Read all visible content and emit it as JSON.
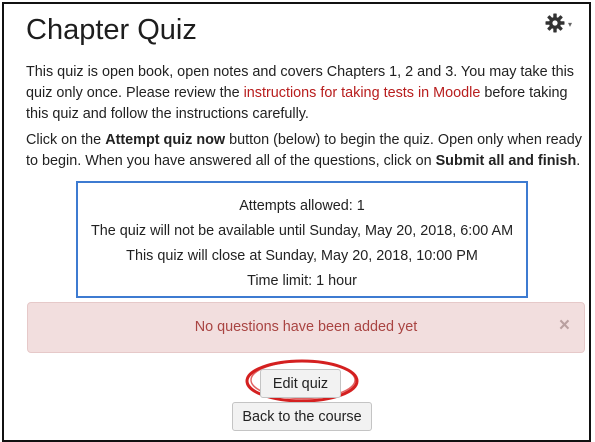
{
  "page": {
    "title": "Chapter Quiz"
  },
  "settings_menu": {
    "icon": "gear-icon",
    "caret": "▾"
  },
  "intro": {
    "part1": "This quiz is open book, open notes and covers Chapters 1, 2 and 3. You may take this quiz only once. Please review the ",
    "link_text": "instructions for taking tests in Moodle",
    "part2": " before taking this quiz and follow the instructions carefully."
  },
  "instructions": {
    "part1": "Click on the ",
    "bold1": "Attempt quiz now",
    "part2": " button (below) to begin the quiz. Open only when ready to begin. When you have answered all of the questions, click on ",
    "bold2": "Submit all and finish",
    "part3": "."
  },
  "quiz_info": {
    "attempts": "Attempts allowed: 1",
    "opens": "The quiz will not be available until Sunday, May 20, 2018, 6:00 AM",
    "closes": "This quiz will close at Sunday, May 20, 2018, 10:00 PM",
    "time_limit": "Time limit: 1 hour"
  },
  "alert": {
    "message": "No questions have been added yet",
    "close_symbol": "×"
  },
  "buttons": {
    "edit_quiz": "Edit quiz",
    "back": "Back to the course"
  },
  "colors": {
    "link": "#b81d1d",
    "info_border": "#3d7bd1",
    "alert_bg": "#f2dede",
    "alert_text": "#a94442",
    "highlight_circle": "#d42020"
  }
}
